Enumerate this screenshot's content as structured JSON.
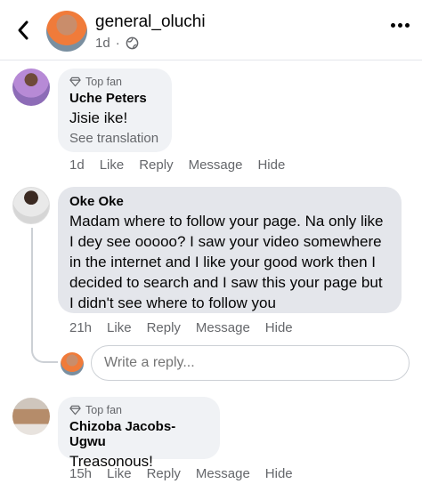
{
  "header": {
    "owner_name": "general_oluchi",
    "post_age": "1d",
    "audience_icon": "globe-icon"
  },
  "comments": [
    {
      "badge": "Top fan",
      "author": "Uche Peters",
      "text": "Jisie ike!",
      "translation": "See translation",
      "time": "1d",
      "actions": [
        "Like",
        "Reply",
        "Message",
        "Hide"
      ]
    },
    {
      "author": "Oke Oke",
      "text": "Madam where to follow your page. Na only like I dey see ooooo? I saw your video somewhere in the internet and I like your good work then I decided to search and I saw this your page but I didn't see where to follow you",
      "time": "21h",
      "actions": [
        "Like",
        "Reply",
        "Message",
        "Hide"
      ]
    },
    {
      "badge": "Top fan",
      "author": "Chizoba Jacobs-Ugwu",
      "text": "Treasonous!",
      "time": "15h",
      "actions": [
        "Like",
        "Reply",
        "Message",
        "Hide"
      ]
    }
  ],
  "reply": {
    "placeholder": "Write a reply..."
  },
  "colors": {
    "bubble": "#f0f2f5",
    "bubble_selected": "#e4e6eb",
    "secondary_text": "#65676b"
  }
}
